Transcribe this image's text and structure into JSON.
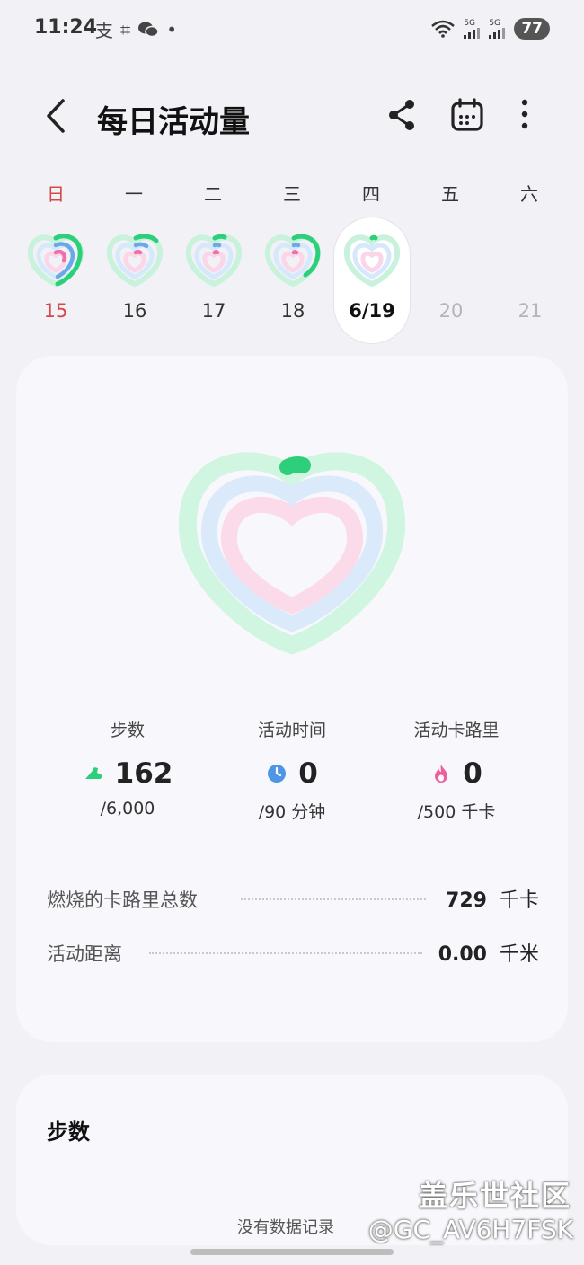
{
  "status": {
    "time": "11:24",
    "left_icons": [
      "支",
      "⌗",
      "wechat-icon",
      "•"
    ],
    "signal1": "5G",
    "signal2": "5G",
    "battery": "77"
  },
  "header": {
    "title": "每日活动量"
  },
  "weekdays": [
    "日",
    "一",
    "二",
    "三",
    "四",
    "五",
    "六"
  ],
  "days": [
    {
      "label": "15",
      "state": "past",
      "sunday": true
    },
    {
      "label": "16",
      "state": "past"
    },
    {
      "label": "17",
      "state": "past"
    },
    {
      "label": "18",
      "state": "past"
    },
    {
      "label": "6/19",
      "state": "selected"
    },
    {
      "label": "20",
      "state": "future"
    },
    {
      "label": "21",
      "state": "future"
    }
  ],
  "stats": [
    {
      "label": "步数",
      "value": "162",
      "goal": "/6,000",
      "icon": "shoe-icon"
    },
    {
      "label": "活动时间",
      "value": "0",
      "goal": "/90 分钟",
      "icon": "clock-icon"
    },
    {
      "label": "活动卡路里",
      "value": "0",
      "goal": "/500 千卡",
      "icon": "flame-icon"
    }
  ],
  "totals": [
    {
      "label": "燃烧的卡路里总数",
      "value": "729",
      "unit": "千卡"
    },
    {
      "label": "活动距离",
      "value": "0.00",
      "unit": "千米"
    }
  ],
  "steps_card": {
    "title": "步数",
    "empty": "没有数据记录"
  },
  "watermark": {
    "line1": "盖乐世社区",
    "line2": "@GC_AV6H7FSK"
  },
  "colors": {
    "ring_green": "#2ecf7a",
    "ring_blue": "#6aa8ea",
    "ring_pink": "#ef6fa8",
    "sunday_red": "#d44848"
  }
}
